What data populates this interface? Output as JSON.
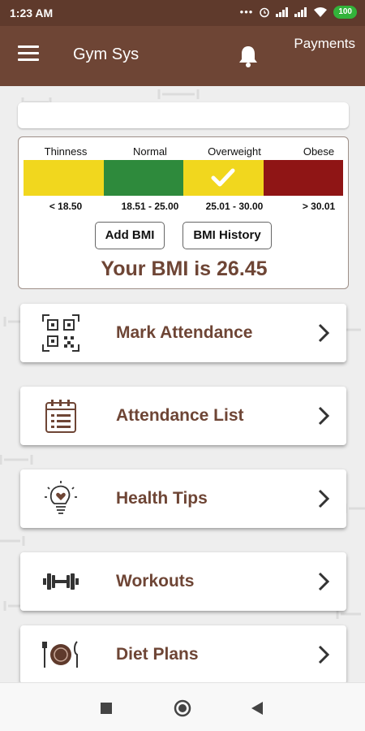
{
  "status_bar": {
    "time": "1:23 AM",
    "battery": "100",
    "dots": "•••"
  },
  "app_bar": {
    "title": "Gym Sys",
    "payments_label": "Payments"
  },
  "bmi": {
    "categories": [
      {
        "label": "Thinness",
        "range": "< 18.50",
        "color": "#f1d71e"
      },
      {
        "label": "Normal",
        "range": "18.51 - 25.00",
        "color": "#2e8a3c"
      },
      {
        "label": "Overweight",
        "range": "25.01 - 30.00",
        "color": "#f1d71e"
      },
      {
        "label": "Obese",
        "range": "> 30.01",
        "color": "#8f1515"
      }
    ],
    "add_button": "Add BMI",
    "history_button": "BMI History",
    "result_text": "Your BMI is 26.45"
  },
  "menu": {
    "items": [
      {
        "label": "Mark Attendance",
        "icon": "qr-code-icon"
      },
      {
        "label": "Attendance List",
        "icon": "calendar-list-icon"
      },
      {
        "label": "Health Tips",
        "icon": "lightbulb-heart-icon"
      },
      {
        "label": "Workouts",
        "icon": "dumbbell-icon"
      },
      {
        "label": "Diet Plans",
        "icon": "plate-fork-knife-icon"
      }
    ]
  },
  "colors": {
    "brand": "#6e4535",
    "status_bar": "#5f3a2c",
    "accent_text": "#6e4535"
  }
}
